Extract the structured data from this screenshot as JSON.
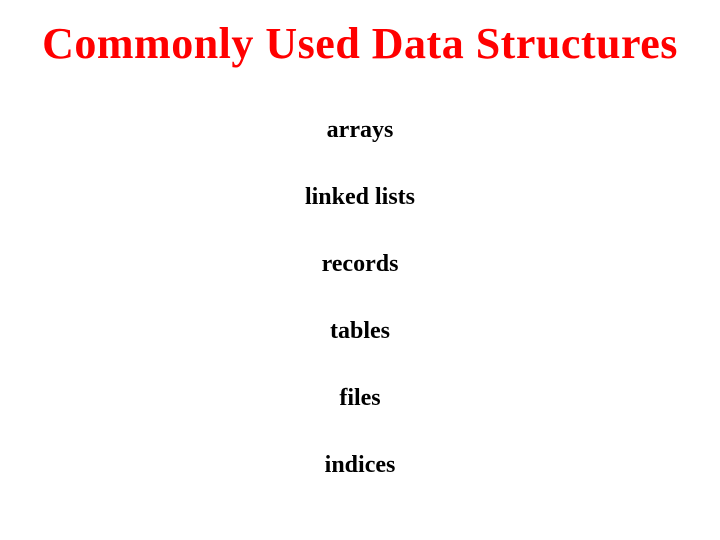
{
  "title": "Commonly Used Data Structures",
  "items": [
    "arrays",
    "linked lists",
    "records",
    "tables",
    "files",
    "indices"
  ]
}
